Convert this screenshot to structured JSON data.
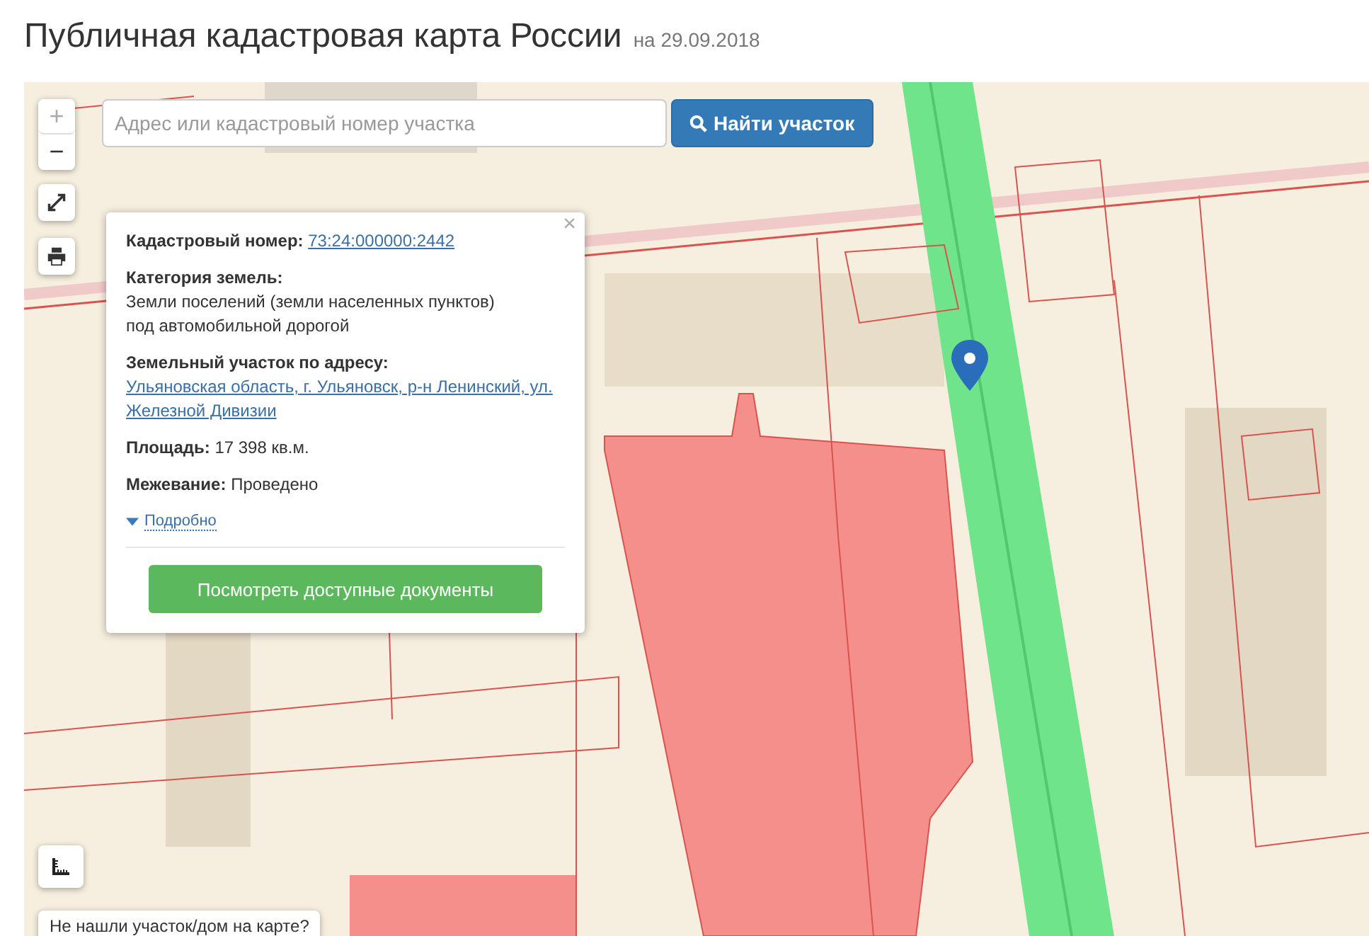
{
  "page": {
    "title": "Публичная кадастровая карта России",
    "date": "на 29.09.2018"
  },
  "search": {
    "placeholder": "Адрес или кадастровый номер участка",
    "button": "Найти участок"
  },
  "zoom_controls": [
    "+",
    "−"
  ],
  "popup": {
    "close": "×",
    "fields": [
      {
        "label": "Кадастровый номер:",
        "value": "73:24:000000:2442",
        "kind": "link"
      },
      {
        "label": "Категория земель:",
        "value": "Земли поселений (земли населенных пунктов)\nпод автомобильной дорогой",
        "kind": "text"
      },
      {
        "label": "Земельный участок по адресу:",
        "value": "Ульяновская область, г. Ульяновск, р-н Ленинский, ул. Железной Дивизии",
        "kind": "link"
      },
      {
        "label": "Площадь:",
        "value": "17 398 кв.м.",
        "kind": "text"
      },
      {
        "label": "Межевание:",
        "value": "Проведено",
        "kind": "text"
      }
    ],
    "details": {
      "label": "Подробно",
      "expanded": false
    },
    "documents_button": "Посмотреть доступные документы"
  },
  "bottom_hint": "Не нашли участок/дом на карте?"
}
